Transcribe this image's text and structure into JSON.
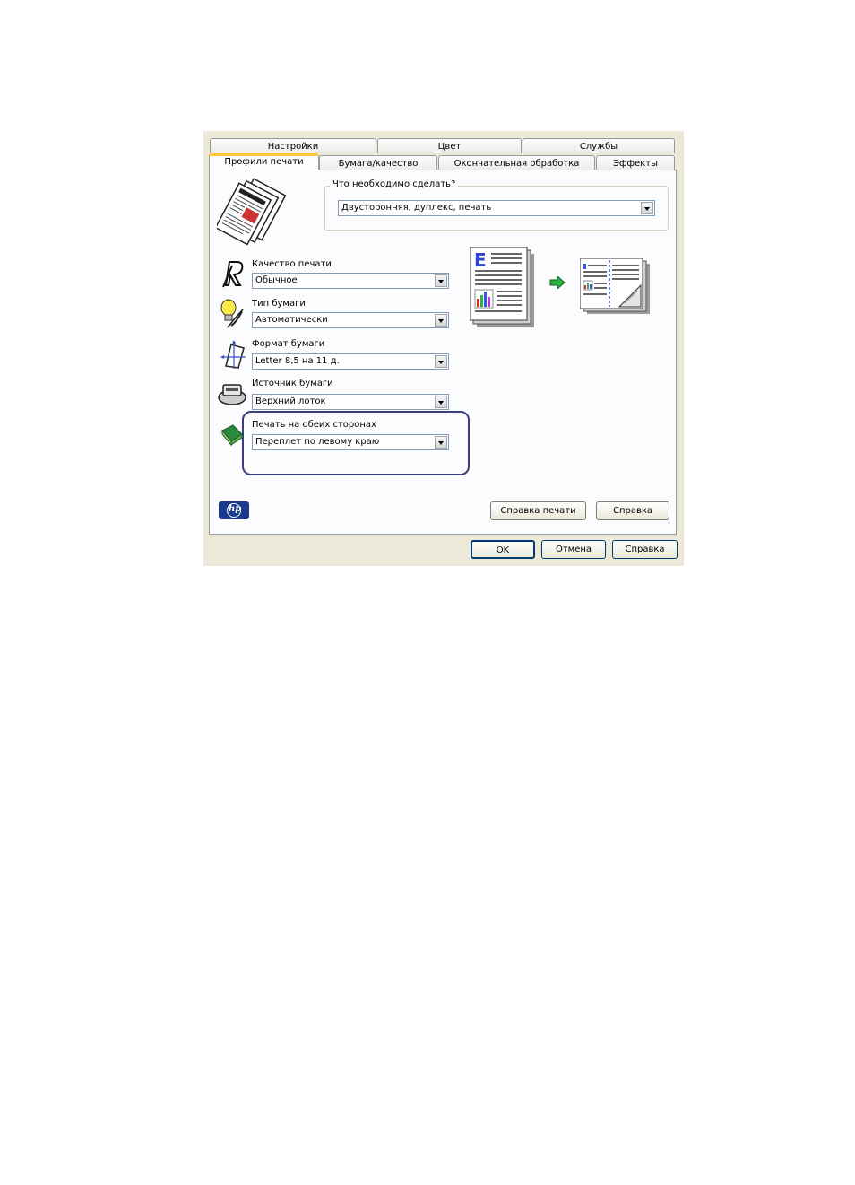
{
  "tabs_row1": [
    "Настройки",
    "Цвет",
    "Службы"
  ],
  "tabs_row2": [
    "Профили печати",
    "Бумага/качество",
    "Окончательная обработка",
    "Эффекты"
  ],
  "group_label": "Что необходимо сделать?",
  "task_select": "Двусторонняя, дуплекс, печать",
  "fields": [
    {
      "label": "Качество печати",
      "value": "Обычное",
      "icon": "quality-icon"
    },
    {
      "label": "Тип бумаги",
      "value": "Автоматически",
      "icon": "lightbulb-icon"
    },
    {
      "label": "Формат бумаги",
      "value": "Letter 8,5 на 11 д.",
      "icon": "paper-size-icon"
    },
    {
      "label": "Источник бумаги",
      "value": "Верхний лоток",
      "icon": "paper-source-icon"
    },
    {
      "label": "Печать на обеих сторонах",
      "value": "Переплет по левому краю",
      "icon": "duplex-icon"
    }
  ],
  "preview_letter": "E",
  "buttons": {
    "print_help": "Справка печати",
    "help": "Справка",
    "ok": "OK",
    "cancel": "Отмена",
    "help2": "Справка"
  },
  "hp_logo": "hp",
  "colors": {
    "highlight": "#3a3f7c",
    "tab_accent": "#ffc83c",
    "dialog_bg": "#ece9d8"
  }
}
